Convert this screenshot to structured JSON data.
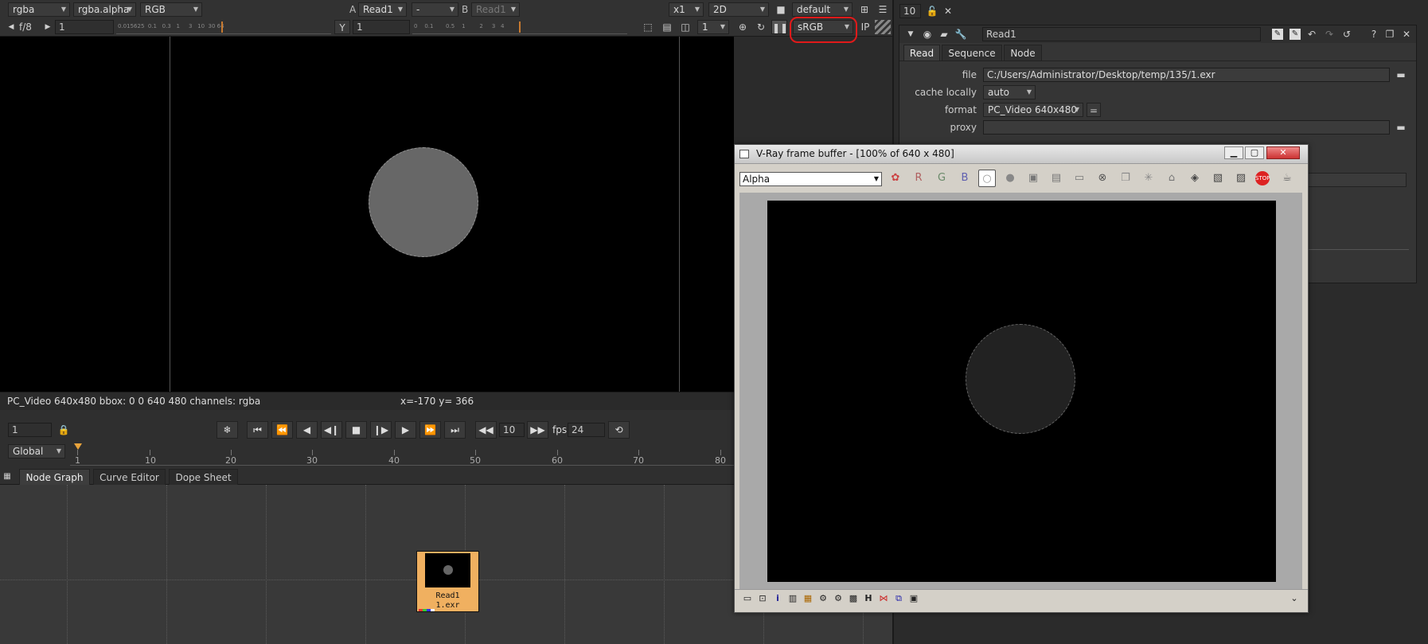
{
  "viewer_toolbar": {
    "channels": "rgba",
    "alpha_channel": "rgba.alpha",
    "display_channels": "RGB",
    "a_label": "A",
    "a_input": "Read1",
    "op": "-",
    "b_label": "B",
    "b_input": "Read1",
    "zoom": "x1",
    "view_mode": "2D",
    "lut": "default",
    "fstop": "f/8",
    "gain": "1",
    "gain_ticks": "0.015625  0.1   0.3   1     3   10  30 64",
    "gamma_label": "Y",
    "gamma": "1",
    "gamma_ticks": "0    0.1       0.5    1        2     3   4",
    "proxy_scale": "1",
    "colorspace": "sRGB",
    "ip": "IP"
  },
  "viewer_status": {
    "info": "PC_Video 640x480 bbox: 0 0 640 480 channels: rgba",
    "coords": "x=-170 y= 366"
  },
  "playback": {
    "frame": "1",
    "increment": "10",
    "fps_label": "fps",
    "fps": "24",
    "range_mode": "Global",
    "ruler": [
      "1",
      "10",
      "20",
      "30",
      "40",
      "50",
      "60",
      "70",
      "80"
    ]
  },
  "panel_tabs": [
    "Node Graph",
    "Curve Editor",
    "Dope Sheet"
  ],
  "node": {
    "name": "Read1",
    "file": "1.exr"
  },
  "properties": {
    "max_panels": "10",
    "node_name": "Read1",
    "tabs": [
      "Read",
      "Sequence",
      "Node"
    ],
    "file_label": "file",
    "file_value": "C:/Users/Administrator/Desktop/temp/135/1.exr",
    "cache_label": "cache locally",
    "cache_value": "auto",
    "format_label": "format",
    "format_value": "PC_Video 640x480",
    "format_eq": "=",
    "proxy_label": "proxy",
    "proxy_value": ""
  },
  "vfb": {
    "title": "V-Ray frame buffer - [100% of 640 x 480]",
    "channel": "Alpha",
    "r": "R",
    "g": "G",
    "b": "B"
  },
  "colors": {
    "annotation": "#e11a1a",
    "node_color": "#f0b060",
    "accent": "#e8a33c"
  }
}
